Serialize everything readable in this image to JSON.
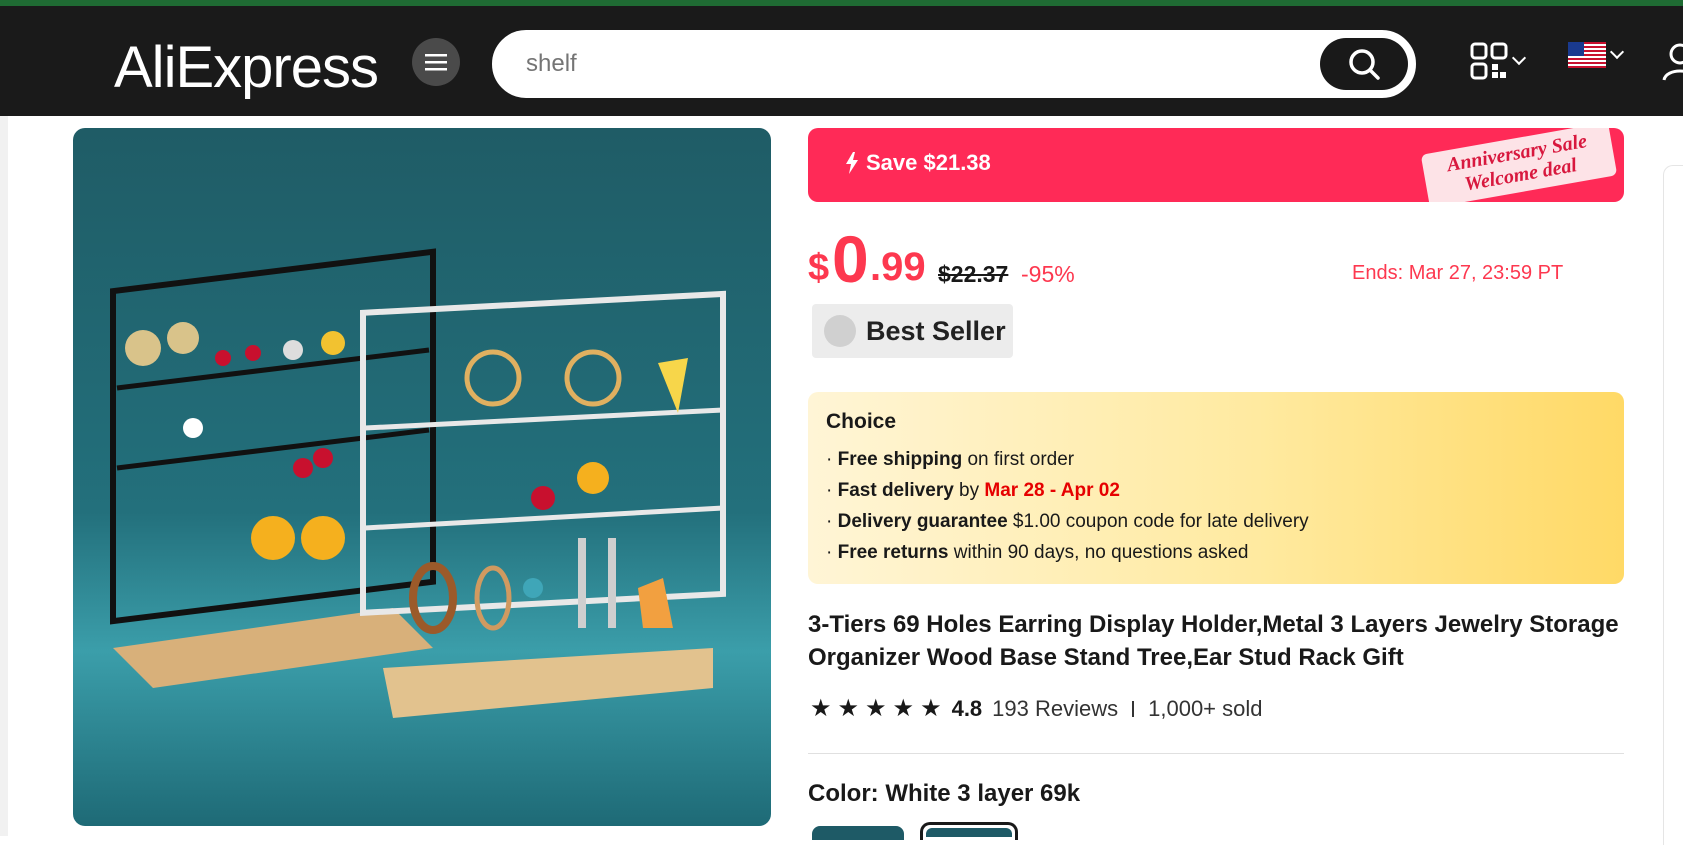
{
  "header": {
    "logo": "AliExpress",
    "search_placeholder": "shelf"
  },
  "promo": {
    "save_label": "Save $21.38",
    "tag_line1": "Anniversary Sale",
    "tag_line2": "Welcome deal"
  },
  "price": {
    "currency": "$",
    "whole": "0",
    "decimal": ".99",
    "original": "$22.37",
    "discount": "-95%",
    "ends": "Ends: Mar 27, 23:59 PT"
  },
  "badge": {
    "label": "Best Seller"
  },
  "choice": {
    "title": "Choice",
    "line1_bold": "Free shipping",
    "line1_rest": " on first order",
    "line2_bold": "Fast delivery",
    "line2_mid": " by ",
    "line2_date": "Mar 28 - Apr 02",
    "line3_bold": "Delivery guarantee",
    "line3_rest": "  $1.00 coupon code for late delivery",
    "line4_bold": "Free returns",
    "line4_rest": "  within 90 days, no questions asked"
  },
  "product": {
    "title": "3-Tiers 69 Holes Earring Display Holder,Metal 3 Layers Jewelry Storage Organizer Wood Base Stand Tree,Ear Stud Rack Gift",
    "rating": "4.8",
    "reviews": "193 Reviews",
    "sold": "1,000+ sold",
    "stars": 5,
    "color_label": "Color: White 3 layer 69k"
  },
  "colors": {
    "accent_red": "#fd384f",
    "header_bg": "#1a1a1a",
    "image_teal": "#23707c"
  }
}
